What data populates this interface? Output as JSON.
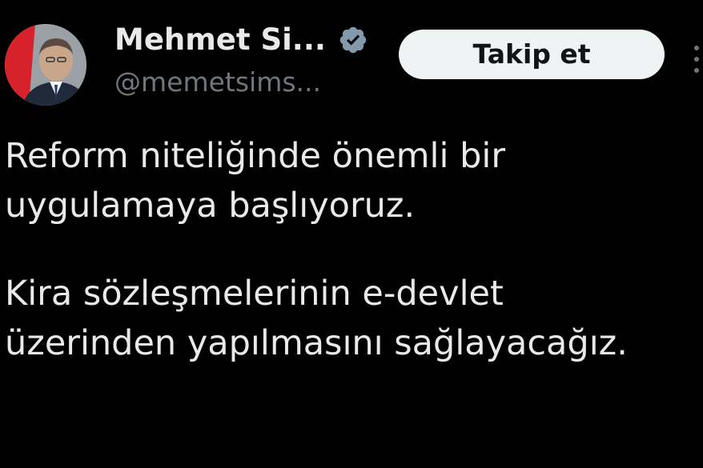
{
  "author": {
    "display_name": "Mehmet Si...",
    "handle": "@memetsims...",
    "verified": true,
    "avatar_icon": "profile-photo"
  },
  "actions": {
    "follow_label": "Takip et",
    "more_icon": "more-vertical-icon"
  },
  "tweet": {
    "paragraph1": {
      "line1": "Reform niteliğinde önemli bir",
      "line2": "uygulamaya başlıyoruz."
    },
    "paragraph2": {
      "line1": "Kira sözleşmelerinin e-devlet",
      "line2": "üzerinden yapılmasını sağlayacağız."
    }
  },
  "colors": {
    "background": "#000000",
    "primary_text": "#e7e9ea",
    "secondary_text": "#71767b",
    "button_bg": "#eff3f4",
    "button_text": "#0f1419",
    "verified_badge": "#829aab"
  }
}
